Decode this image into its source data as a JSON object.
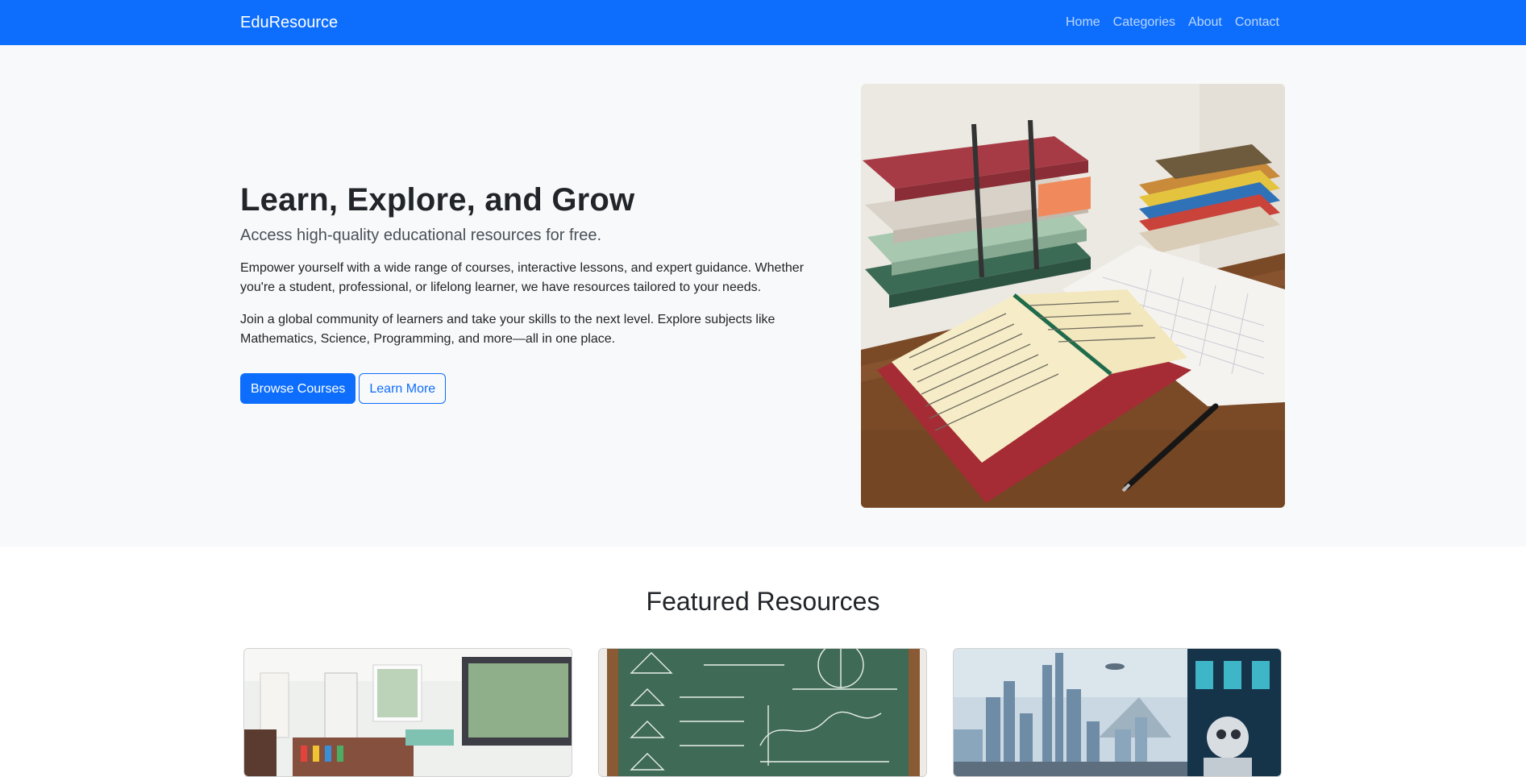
{
  "navbar": {
    "brand": "EduResource",
    "links": [
      "Home",
      "Categories",
      "About",
      "Contact"
    ]
  },
  "hero": {
    "title": "Learn, Explore, and Grow",
    "subtitle": "Access high-quality educational resources for free.",
    "paragraph1": "Empower yourself with a wide range of courses, interactive lessons, and expert guidance. Whether you're a student, professional, or lifelong learner, we have resources tailored to your needs.",
    "paragraph2": "Join a global community of learners and take your skills to the next level. Explore subjects like Mathematics, Science, Programming, and more—all in one place.",
    "primary_button": "Browse Courses",
    "secondary_button": "Learn More"
  },
  "featured": {
    "title": "Featured Resources"
  },
  "colors": {
    "brand": "#0d6efd",
    "hero_bg": "#f8f9fa",
    "text": "#212529"
  }
}
